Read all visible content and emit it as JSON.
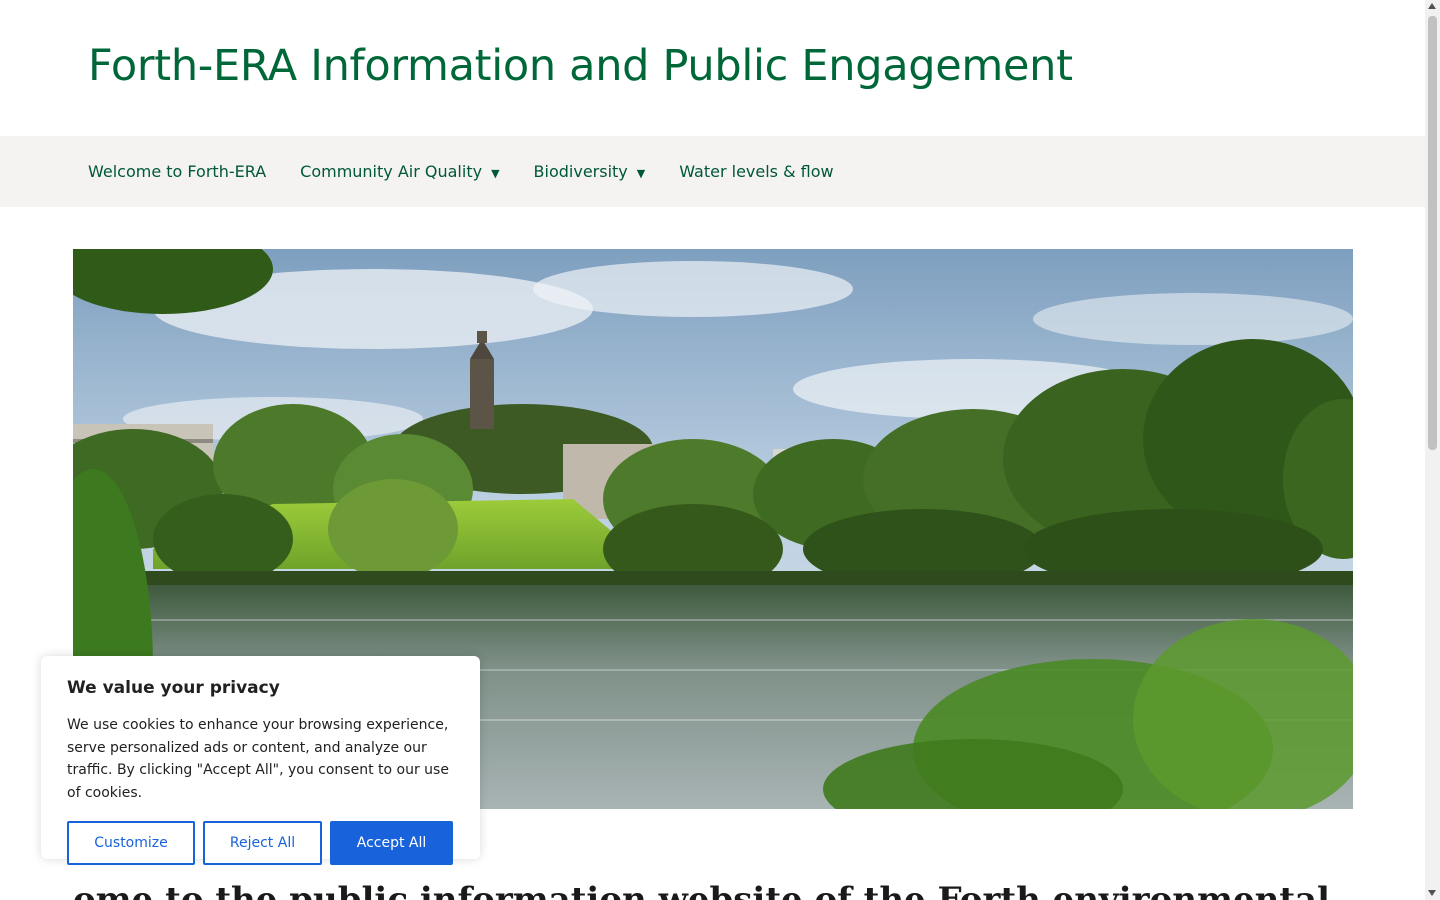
{
  "header": {
    "site_title": "Forth-ERA Information and Public Engagement"
  },
  "nav": {
    "items": [
      {
        "label": "Welcome to Forth-ERA",
        "has_dropdown": false
      },
      {
        "label": "Community Air Quality",
        "has_dropdown": true
      },
      {
        "label": "Biodiversity",
        "has_dropdown": true
      },
      {
        "label": "Water levels & flow",
        "has_dropdown": false
      }
    ],
    "caret": "▼"
  },
  "hero": {
    "icon": "landscape-photo"
  },
  "main": {
    "lead_text": "ome to the public information website of the Forth environmental"
  },
  "cookie_banner": {
    "title": "We value your privacy",
    "body": "We use cookies to enhance your browsing experience, serve personalized ads or content, and analyze our traffic. By clicking \"Accept All\", you consent to our use of cookies.",
    "buttons": {
      "customize": "Customize",
      "reject": "Reject All",
      "accept": "Accept All"
    }
  },
  "colors": {
    "brand_green": "#006838",
    "nav_bg": "#f4f3f1",
    "accent_blue": "#1863dc"
  }
}
